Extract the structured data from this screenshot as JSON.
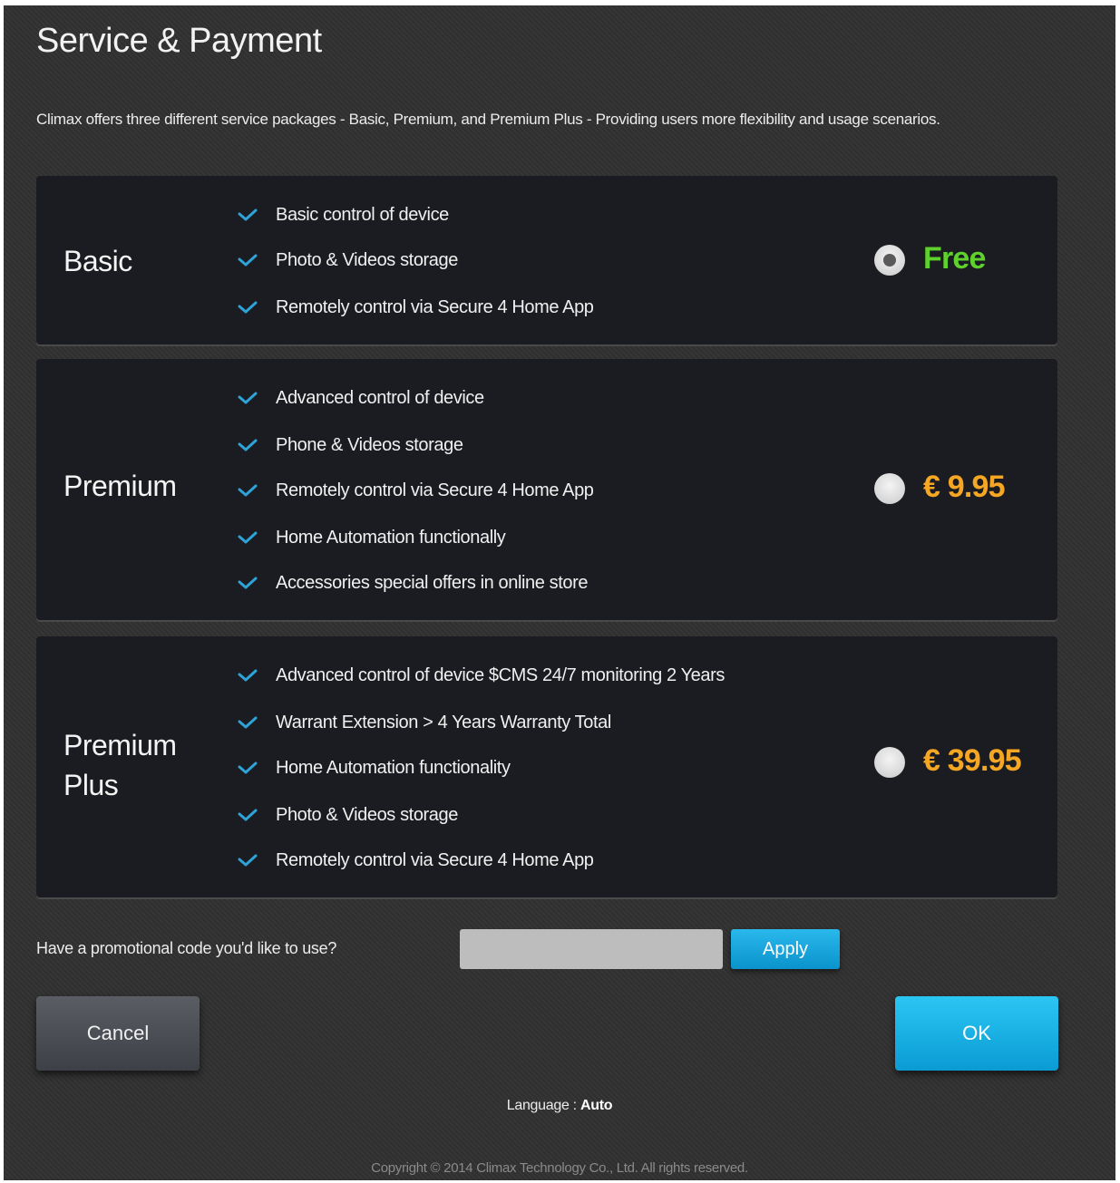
{
  "page": {
    "title": "Service & Payment",
    "intro": "Climax offers three different service packages - Basic, Premium, and Premium Plus - Providing users more flexibility and usage scenarios."
  },
  "packages": [
    {
      "name": "Basic",
      "price": "Free",
      "price_color": "#5fd12c",
      "selected": true,
      "features": [
        "Basic control of device",
        "Photo & Videos storage",
        "Remotely control via Secure 4 Home App"
      ]
    },
    {
      "name": "Premium",
      "price": "€ 9.95",
      "price_color": "#f5a623",
      "selected": false,
      "features": [
        "Advanced control of device",
        "Phone & Videos storage",
        "Remotely control via Secure 4 Home App",
        "Home Automation functionally",
        "Accessories special offers in online store"
      ]
    },
    {
      "name": "Premium Plus",
      "price": "€ 39.95",
      "price_color": "#f5a623",
      "selected": false,
      "features": [
        "Advanced control of device $CMS 24/7 monitoring 2 Years",
        "Warrant Extension > 4 Years Warranty Total",
        "Home Automation functionality",
        "Photo & Videos storage",
        "Remotely control via Secure 4 Home App"
      ]
    }
  ],
  "promo": {
    "label": "Have a promotional code you'd like to use?",
    "value": "",
    "apply_label": "Apply"
  },
  "actions": {
    "cancel_label": "Cancel",
    "ok_label": "OK"
  },
  "footer": {
    "language_label": "Language :",
    "language_value": "Auto",
    "copyright": "Copyright © 2014 Climax Technology Co., Ltd. All rights reserved."
  },
  "icons": {
    "feature": "check-icon",
    "check_color": "#2ea3d8"
  }
}
